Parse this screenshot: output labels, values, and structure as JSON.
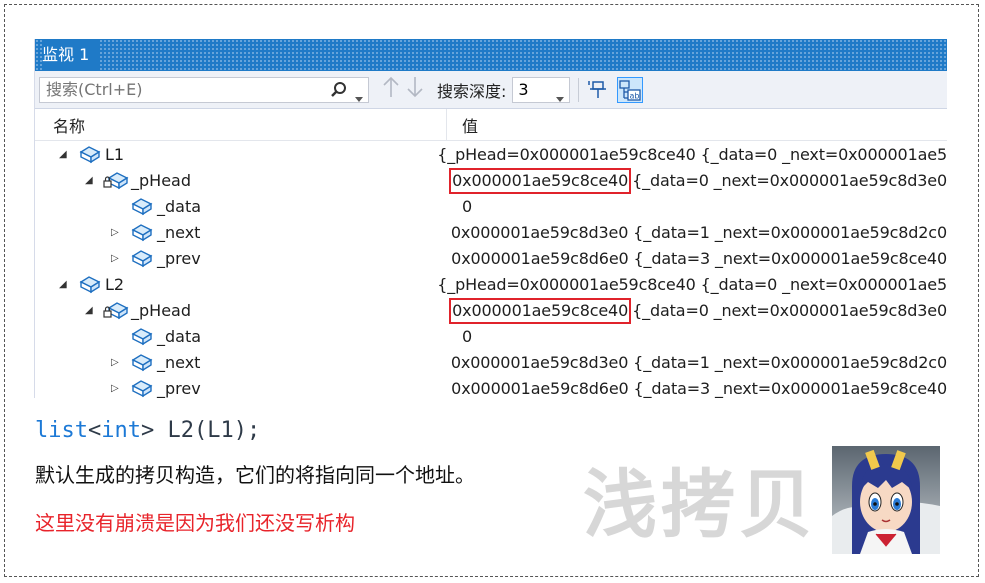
{
  "watch": {
    "title": "监视 1",
    "search_placeholder": "搜索(Ctrl+E)",
    "depth_label": "搜索深度:",
    "depth_value": "3",
    "col_name": "名称",
    "col_value": "值",
    "rows": [
      {
        "name": "L1",
        "val_pre": "",
        "val_addr": "{_pHead=0x000001ae59c8ce40",
        "val_post": " {_data=0 _next=0x000001ae5"
      },
      {
        "name": "_pHead",
        "val_pre": "",
        "val_addr": "0x000001ae59c8ce40",
        "val_post": "{_data=0 _next=0x000001ae59c8d3e0"
      },
      {
        "name": "_data",
        "val_pre": "",
        "val_addr": "0",
        "val_post": ""
      },
      {
        "name": "_next",
        "val_pre": "",
        "val_addr": "0x000001ae59c8d3e0",
        "val_post": " {_data=1 _next=0x000001ae59c8d2c0"
      },
      {
        "name": "_prev",
        "val_pre": "",
        "val_addr": "0x000001ae59c8d6e0",
        "val_post": " {_data=3 _next=0x000001ae59c8ce40"
      },
      {
        "name": "L2",
        "val_pre": "",
        "val_addr": "{_pHead=0x000001ae59c8ce40",
        "val_post": " {_data=0 _next=0x000001ae5"
      },
      {
        "name": "_pHead",
        "val_pre": "",
        "val_addr": "0x000001ae59c8ce40",
        "val_post": "{_data=0 _next=0x000001ae59c8d3e0"
      },
      {
        "name": "_data",
        "val_pre": "",
        "val_addr": "0",
        "val_post": ""
      },
      {
        "name": "_next",
        "val_pre": "",
        "val_addr": "0x000001ae59c8d3e0",
        "val_post": " {_data=1 _next=0x000001ae59c8d2c0"
      },
      {
        "name": "_prev",
        "val_pre": "",
        "val_addr": "0x000001ae59c8d6e0",
        "val_post": " {_data=3 _next=0x000001ae59c8ce40"
      }
    ]
  },
  "code": {
    "kw1": "list",
    "lt": "<",
    "kw2": "int",
    "rest": "> L2(L1);"
  },
  "notes": {
    "line1": "默认生成的拷贝构造，它们的将指向同一个地址。",
    "line2": "这里没有崩溃是因为我们还没写析构"
  },
  "watermark": "浅拷贝",
  "colors": {
    "accent": "#1f7ac7",
    "highlight": "#e0232b",
    "keyword": "#1c79d6"
  }
}
